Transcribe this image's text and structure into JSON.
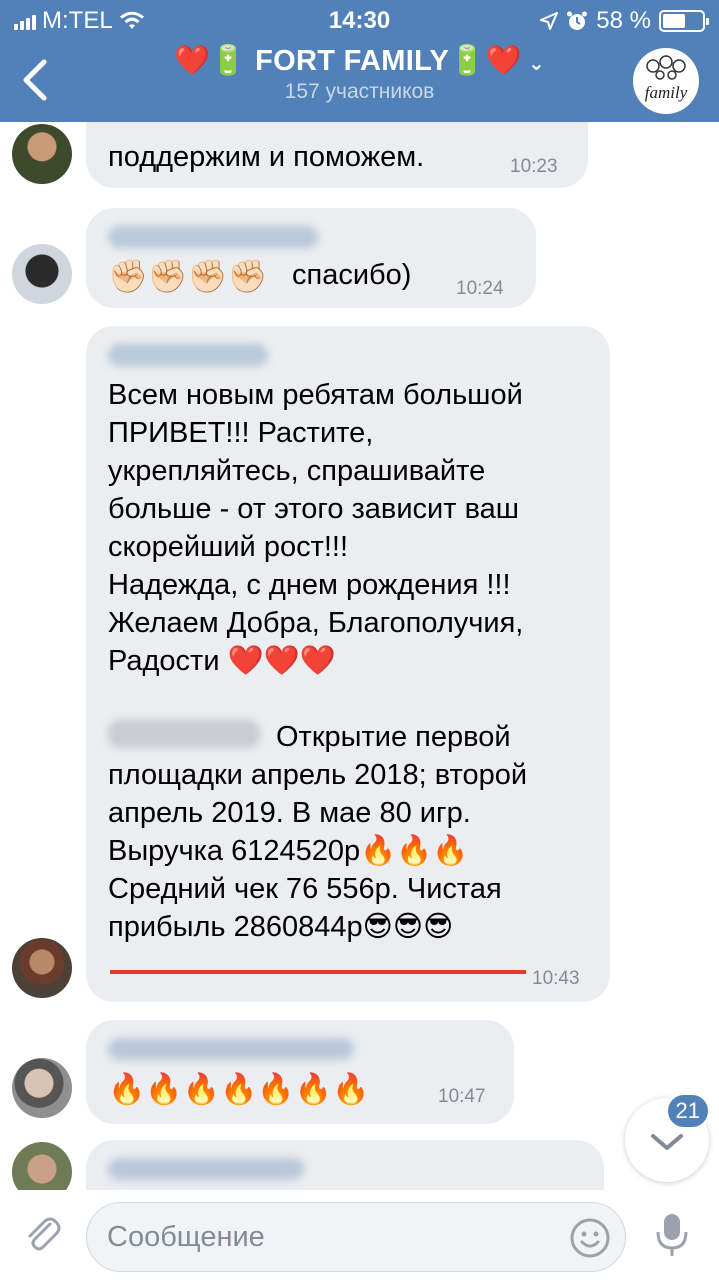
{
  "status_bar": {
    "carrier": "M:TEL",
    "time": "14:30",
    "battery_percent": "58 %",
    "battery_level": 0.58
  },
  "header": {
    "title": "❤️🔋 FORT FAMILY🔋❤️",
    "subtitle": "157 участников",
    "avatar_text": "family"
  },
  "messages": [
    {
      "text": "поддержим и поможем.",
      "time": "10:23"
    },
    {
      "emojis": "✊🏻✊🏻✊🏻✊🏻",
      "text": "спасибо)",
      "time": "10:24"
    },
    {
      "paragraphs": [
        "Всем новым ребятам большой\nПРИВЕТ!!! Растите,\nукрепляйтесь, спрашивайте\nбольше - от этого зависит ваш\nскорейший рост!!!\nНадежда, с днем рождения !!!\nЖелаем Добра, Благополучия,\nРадости ❤️❤️❤️",
        "Открытие первой",
        "площадки апрель 2018; второй\nапрель 2019. В мае 80 игр.\nВыручка 6124520р🔥🔥🔥\nСредний чек 76 556р. Чистая\nприбыль 2860844р😎😎😎"
      ],
      "time": "10:43"
    },
    {
      "emojis": "🔥🔥🔥🔥🔥🔥🔥",
      "time": "10:47"
    }
  ],
  "scroll_badge": "21",
  "composer": {
    "placeholder": "Сообщение"
  },
  "colors": {
    "header_bg": "#5181b8",
    "bubble_bg": "#ebedf0",
    "time_text": "#818c99",
    "underline": "#e6382b"
  }
}
